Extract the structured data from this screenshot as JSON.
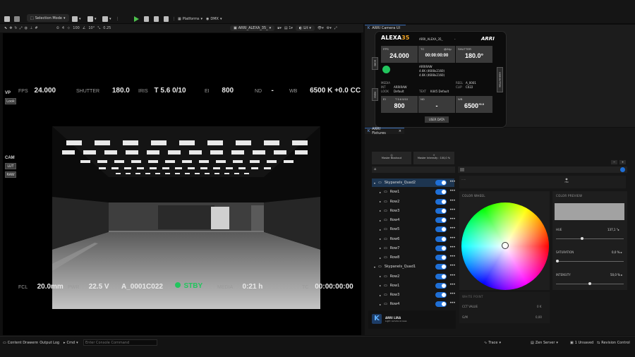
{
  "toolbar": {
    "selection_mode": "Selection Mode",
    "platforms": "Platforms",
    "dmx": "DMX"
  },
  "viewport_toolbar": {
    "speed": "4",
    "zoom": "100",
    "angle": "10°",
    "scale": "0.25",
    "camera": "ARRI_ALEXA_35_",
    "lit": "Lit"
  },
  "hud": {
    "fps_label": "FPS",
    "fps_value": "24.000",
    "shutter_label": "SHUTTER",
    "shutter_value": "180.0",
    "iris_label": "IRIS",
    "iris_value": "T 5.6  0/10",
    "ei_label": "EI",
    "ei_value": "800",
    "nd_label": "ND",
    "nd_value": "-",
    "wb_label": "WB",
    "wb_value": "6500 K +0.0 CC",
    "fcl_label": "FCL",
    "fcl_value": "20.0mm",
    "pwr_label": "PWR",
    "pwr_value": "22.5 V",
    "clip_value": "A_0001C022",
    "stby_value": "STBY",
    "media_label": "MEDIA",
    "media_value": "0:21 h",
    "tc_label": "TC",
    "tc_value": "00:00:00:00",
    "vp_label": "VP",
    "look_btn": "Look",
    "cam_label": "CAM",
    "lut_btn": "LUT",
    "raw_btn": "RAW",
    "stby_color": "#22c55e"
  },
  "tabs": {
    "camera_ui": "ARRI Camera UI",
    "fixtures": "ARRI Fixtures"
  },
  "camera_ui": {
    "brand": "ALEXA",
    "brand_num": "35",
    "cam_name": "ARRI_ALEXA_35_",
    "arri": "ARRI",
    "fps_label": "FPS",
    "fps_value": "24.000",
    "tc_label": "TC",
    "tc_value": "00:00:00:00",
    "tc_rate": "@24p",
    "shutter_label": "SHUTTER",
    "shutter_value": "180.0°",
    "codec": "ARRIRAW",
    "res1": "4.6K (4608x2160)",
    "res2": "4.6K (4608x2160)",
    "media_label": "MEDIA",
    "int_label": "INT",
    "int_value": "ARRIRAW",
    "look_label": "LOOK",
    "look_value": "Default",
    "reel_label": "REEL",
    "reel_value": "A_0001",
    "clip_label": "CLIP",
    "clip_value": "C022",
    "text_label": "TEXT",
    "text_value": "K445 Default",
    "ei_label": "EI",
    "ei_sub": "T 5.6 0/10",
    "ei_value": "800",
    "nd_label": "ND",
    "nd_value": "-",
    "wb_label": "WB",
    "wb_value": "6500",
    "wb_sup": "+0.0",
    "user_data": "USER DATA",
    "side_left_1": "HOME",
    "side_left_2": "MENU",
    "side_right": "USER BUTTON"
  },
  "fixtures": {
    "master_blackout": "Master Blackout",
    "master_intensity": "Master Intensity : 100,0 %",
    "tree": [
      {
        "label": "Skypanels_Quad2",
        "level": 0
      },
      {
        "label": "Row1",
        "level": 1
      },
      {
        "label": "Row2",
        "level": 1
      },
      {
        "label": "Row3",
        "level": 1
      },
      {
        "label": "Row4",
        "level": 1
      },
      {
        "label": "Row5",
        "level": 1
      },
      {
        "label": "Row6",
        "level": 1
      },
      {
        "label": "Row7",
        "level": 1
      },
      {
        "label": "Row8",
        "level": 1
      },
      {
        "label": "Skypanels_Quad1",
        "level": 0
      },
      {
        "label": "Row2",
        "level": 1
      },
      {
        "label": "Row1",
        "level": 1
      },
      {
        "label": "Row3",
        "level": 1
      },
      {
        "label": "Row4",
        "level": 1
      }
    ],
    "logo_title": "ARRI LiRA",
    "logo_sub": "Light remote Access",
    "hsi": "HSI",
    "color_wheel": "COLOR WHEEL",
    "color_preview": "COLOR PREVIEW",
    "hue_label": "HUE",
    "hue_value": "137,1",
    "hue_level": 0.38,
    "saturation_label": "SATURATION",
    "saturation_value": "0,0 %",
    "saturation_level": 0.0,
    "intensity_label": "INTENSITY",
    "intensity_value": "50,0 %",
    "intensity_level": 0.5,
    "white_point": "WHITE POINT",
    "cct_label": "CCT VALUE",
    "cct_value": "0 K",
    "gm_label": "G/M",
    "gm_value": "0,00"
  },
  "statusbar": {
    "content_drawer": "Content Drawer",
    "output_log": "Output Log",
    "cmd": "Cmd",
    "console_placeholder": "Enter Console Command",
    "trace": "Trace",
    "zen_server": "Zen Server",
    "unsaved": "1 Unsaved",
    "revision": "Revision Control"
  }
}
